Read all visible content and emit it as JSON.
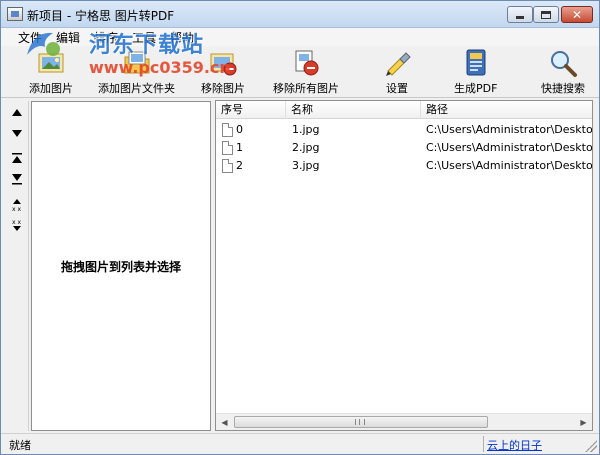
{
  "window": {
    "title": "新项目 - 宁格思 图片转PDF"
  },
  "menu": [
    "文件",
    "编辑",
    "排序",
    "工具",
    "帮助"
  ],
  "watermark": {
    "site_name": "河东下载站",
    "url": "www.pc0359.cn"
  },
  "toolbar": {
    "add_image": "添加图片",
    "add_folder": "添加图片文件夹",
    "remove_image": "移除图片",
    "remove_all": "移除所有图片",
    "settings": "设置",
    "generate_pdf": "生成PDF",
    "quick_search": "快捷搜索"
  },
  "drop_area": {
    "hint": "拖拽图片到列表并选择"
  },
  "list": {
    "columns": [
      "序号",
      "名称",
      "路径"
    ],
    "rows": [
      {
        "index": "0",
        "name": "1.jpg",
        "path": "C:\\Users\\Administrator\\Desktop"
      },
      {
        "index": "1",
        "name": "2.jpg",
        "path": "C:\\Users\\Administrator\\Desktop"
      },
      {
        "index": "2",
        "name": "3.jpg",
        "path": "C:\\Users\\Administrator\\Desktop"
      }
    ]
  },
  "status": {
    "text": "就绪",
    "link": "云上的日子"
  },
  "colors": {
    "title_gradient_top": "#dbe9f8",
    "close_button": "#c74a33",
    "watermark_blue": "#1f6fcf",
    "watermark_red": "#e4462a",
    "link": "#0033cc"
  },
  "icons": {
    "side_buttons": [
      "move-up-icon",
      "move-down-icon",
      "move-top-icon",
      "move-bottom-icon",
      "sort-asc-icon",
      "sort-desc-icon"
    ]
  }
}
